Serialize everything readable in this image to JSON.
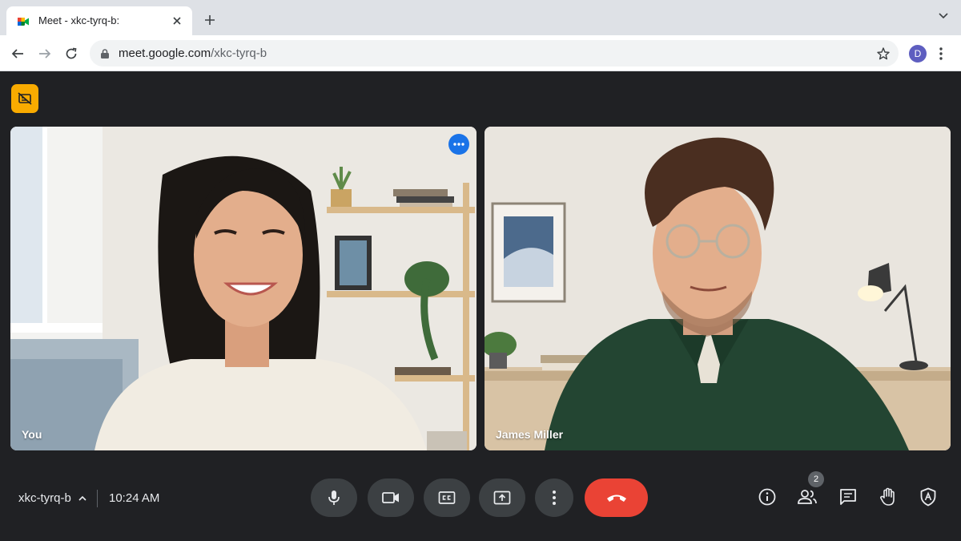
{
  "browser": {
    "tab_title": "Meet - xkc-tyrq-b:",
    "url_host": "meet.google.com",
    "url_path": "/xkc-tyrq-b",
    "profile_initial": "D"
  },
  "meet": {
    "tiles": [
      {
        "name": "You"
      },
      {
        "name": "James Miller"
      }
    ],
    "meeting_code": "xkc-tyrq-b",
    "time": "10:24 AM",
    "people_count": "2"
  },
  "colors": {
    "background": "#202124",
    "control_button": "#3c4043",
    "end_call": "#ea4335",
    "notice_badge": "#f9ab00",
    "accent_blue": "#1a73e8"
  },
  "icons": {
    "notice": "no-captions-icon",
    "controls": [
      "mic-icon",
      "camera-icon",
      "captions-icon",
      "present-icon",
      "more-vert-icon",
      "end-call-icon"
    ],
    "side": [
      "info-icon",
      "people-icon",
      "chat-icon",
      "raise-hand-icon",
      "host-controls-icon"
    ]
  }
}
